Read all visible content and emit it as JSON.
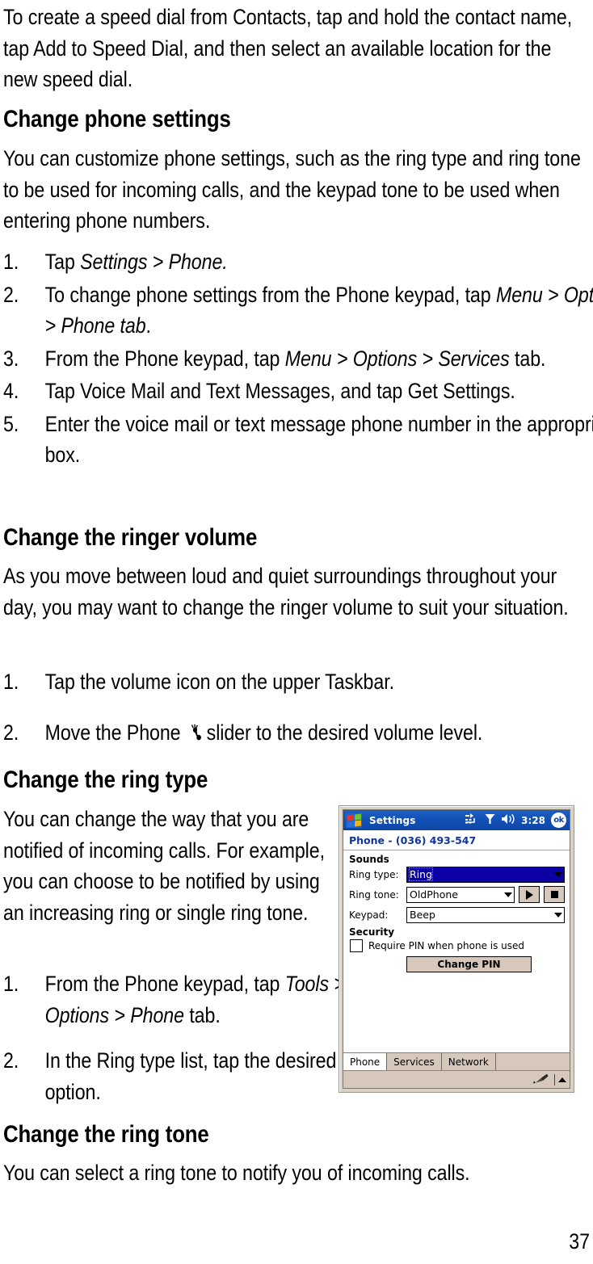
{
  "page": {
    "number": "37"
  },
  "intro": {
    "paragraph": "To create a speed dial from Contacts, tap and hold the contact name, tap Add to Speed Dial, and then select an available location for the new speed dial."
  },
  "sections": {
    "phone_settings": {
      "heading": "Change phone settings",
      "paragraph": "You can customize phone settings, such as the ring type and ring tone to be used for incoming calls, and the keypad tone to be used when entering phone numbers.",
      "steps": [
        {
          "num": "1.",
          "pre": "Tap ",
          "em": "Settings > Phone.",
          "post": ""
        },
        {
          "num": "2.",
          "pre": "To change phone settings from the Phone keypad, tap ",
          "em": "Menu > Options > Phone tab",
          "post": "."
        },
        {
          "num": "3.",
          "pre": "From the Phone keypad, tap ",
          "em": "Menu > Options > Services",
          "post": " tab."
        },
        {
          "num": "4.",
          "pre": "Tap Voice Mail and Text Messages, and tap Get Settings.",
          "em": "",
          "post": ""
        },
        {
          "num": "5.",
          "pre": "Enter the voice mail or text message phone number in the appropriate box.",
          "em": "",
          "post": ""
        }
      ]
    },
    "ringer_volume": {
      "heading": "Change the ringer volume",
      "paragraph": "As you move between loud and quiet surroundings throughout your day, you may want to change the ringer volume to suit your situation.",
      "steps": [
        {
          "num": "1.",
          "text": "Tap the volume icon on the upper Taskbar."
        },
        {
          "num": "2.",
          "pre": "Move the Phone ",
          "icon": "phone-ringer-icon",
          "post": "slider to the desired volume level."
        }
      ]
    },
    "ring_type": {
      "heading": "Change the ring type",
      "paragraph": "You can change the way that you are notified of incoming calls. For example, you can choose to be notified by using an increasing ring or single ring tone.",
      "steps": [
        {
          "num": "1.",
          "pre": "From the Phone keypad, tap ",
          "em": "Tools > Options > Phone",
          "post": " tab."
        },
        {
          "num": "2.",
          "pre": "In the Ring type list, tap the desired option.",
          "em": "",
          "post": ""
        }
      ]
    },
    "ring_tone": {
      "heading": "Change the ring tone",
      "paragraph": "You can select a ring tone to notify you of incoming calls."
    }
  },
  "screenshot": {
    "titlebar": {
      "app_title": "Settings",
      "clock": "3:28",
      "ok_label": "ok",
      "icons": [
        "windows-logo-icon",
        "connectivity-icon",
        "signal-icon",
        "volume-icon"
      ]
    },
    "subtitle": "Phone - (036) 493-547",
    "groups": {
      "sounds": {
        "label": "Sounds",
        "fields": [
          {
            "label": "Ring type:",
            "value": "Ring",
            "selected": true
          },
          {
            "label": "Ring tone:",
            "value": "OldPhone",
            "selected": false
          },
          {
            "label": "Keypad:",
            "value": "Beep",
            "selected": false
          }
        ],
        "play_button": "play-icon",
        "stop_button": "stop-icon"
      },
      "security": {
        "label": "Security",
        "checkbox_label": "Require PIN when phone is used",
        "checkbox_checked": false,
        "change_pin_label": "Change PIN"
      }
    },
    "tabs": [
      {
        "label": "Phone",
        "active": true
      },
      {
        "label": "Services",
        "active": false
      },
      {
        "label": "Network",
        "active": false
      }
    ],
    "statusbar": {
      "sip_icon": "input-panel-icon",
      "arrow_icon": "chevron-up-icon"
    },
    "colors": {
      "titlebar_blue": "#1350b5",
      "subtitle_blue": "#10349b",
      "selection_blue": "#0b00a5",
      "chrome_beige": "#d6c8bb"
    }
  }
}
